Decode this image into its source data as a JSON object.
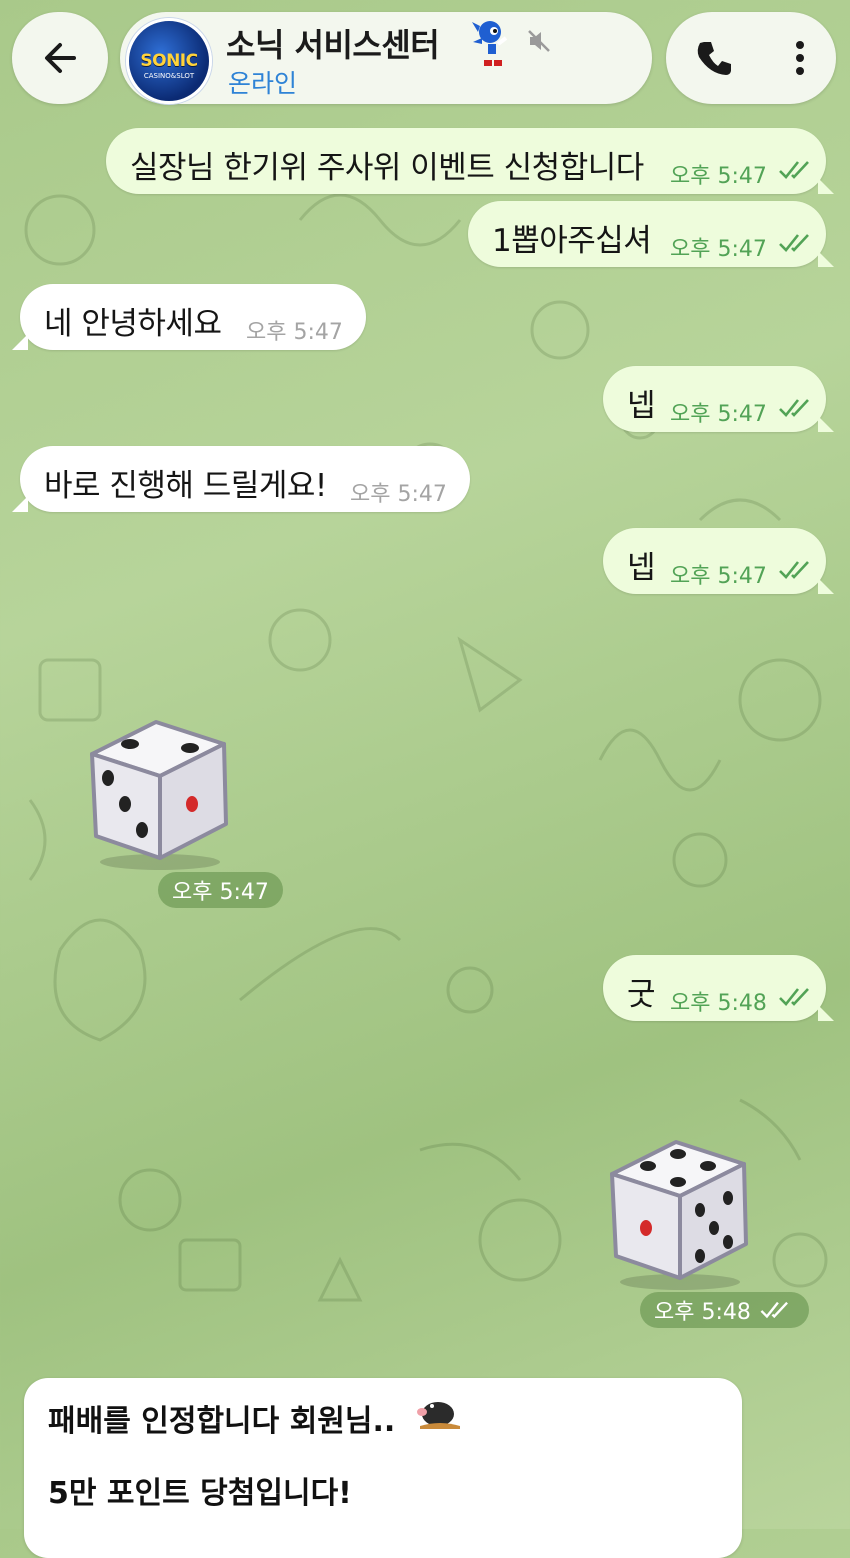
{
  "header": {
    "back_icon": "arrow-left-icon",
    "avatar_text": "SONIC",
    "avatar_subtext": "CASINO&SLOT",
    "chat_name": "소닉 서비스센터",
    "status": "온라인",
    "name_badge_icon": "sonic-character-icon",
    "mute_icon": "muted-speaker-icon",
    "call_icon": "phone-icon",
    "menu_icon": "more-vertical-icon"
  },
  "messages": [
    {
      "dir": "out",
      "text": "실장님 한기위 주사위 이벤트 신청합니다",
      "time": "오후 5:47",
      "read": true
    },
    {
      "dir": "out",
      "text": "1뽑아주십셔",
      "time": "오후 5:47",
      "read": true
    },
    {
      "dir": "in",
      "text": "네 안녕하세요",
      "time": "오후 5:47"
    },
    {
      "dir": "out",
      "text": "넵",
      "time": "오후 5:47",
      "read": true
    },
    {
      "dir": "in",
      "text": "바로 진행해 드릴게요!",
      "time": "오후 5:47"
    },
    {
      "dir": "out",
      "text": "넵",
      "time": "오후 5:47",
      "read": true
    },
    {
      "dir": "in",
      "type": "dice",
      "value": 1,
      "time": "오후 5:47"
    },
    {
      "dir": "out",
      "text": "굿",
      "time": "오후 5:48",
      "read": true
    },
    {
      "dir": "out",
      "type": "dice",
      "value": 1,
      "time": "오후 5:48",
      "read": true
    }
  ],
  "last_message": {
    "line1": "패배를 인정합니다 회원님..",
    "emoji_icon": "mole-emoji-icon",
    "line2": "5만 포인트 당첨입니다!"
  },
  "colors": {
    "outgoing_bubble": "#eefcdc",
    "incoming_bubble": "#ffffff",
    "outgoing_time": "#52a356",
    "status_blue": "#2e83d6",
    "dice_pip_red": "#d42a2a"
  }
}
